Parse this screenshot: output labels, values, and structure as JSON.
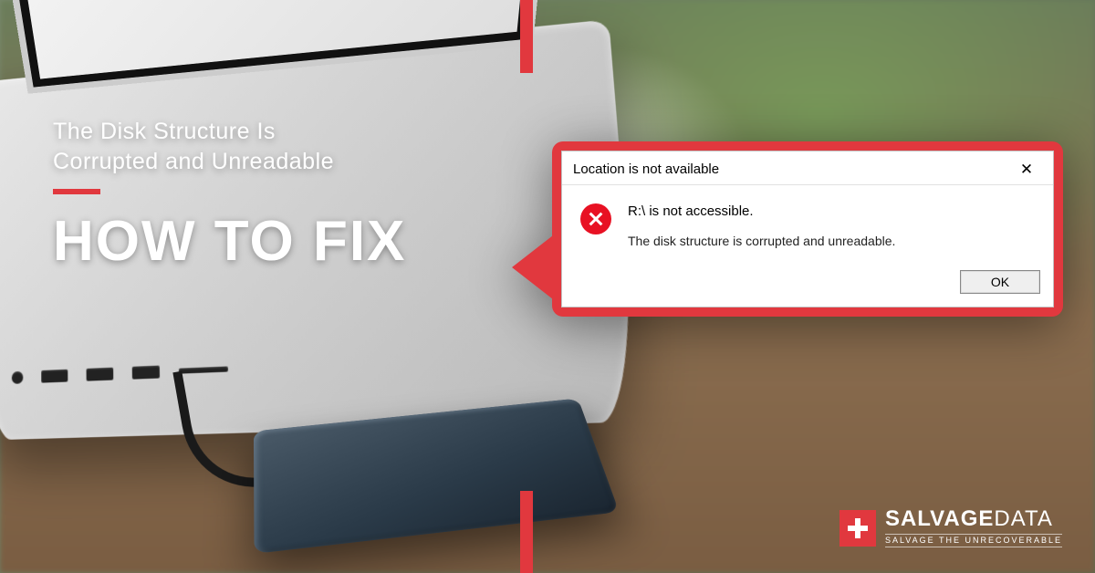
{
  "headline": {
    "subtitle_line1": "The Disk Structure Is",
    "subtitle_line2": "Corrupted and Unreadable",
    "title": "HOW TO FIX"
  },
  "dialog": {
    "title": "Location is not available",
    "close_glyph": "✕",
    "message_line1": "R:\\ is not accessible.",
    "message_line2": "The disk structure is corrupted and unreadable.",
    "ok_label": "OK"
  },
  "logo": {
    "brand_bold": "SALVAGE",
    "brand_light": "DATA",
    "tagline": "SALVAGE THE UNRECOVERABLE"
  },
  "colors": {
    "accent": "#e1383e"
  }
}
